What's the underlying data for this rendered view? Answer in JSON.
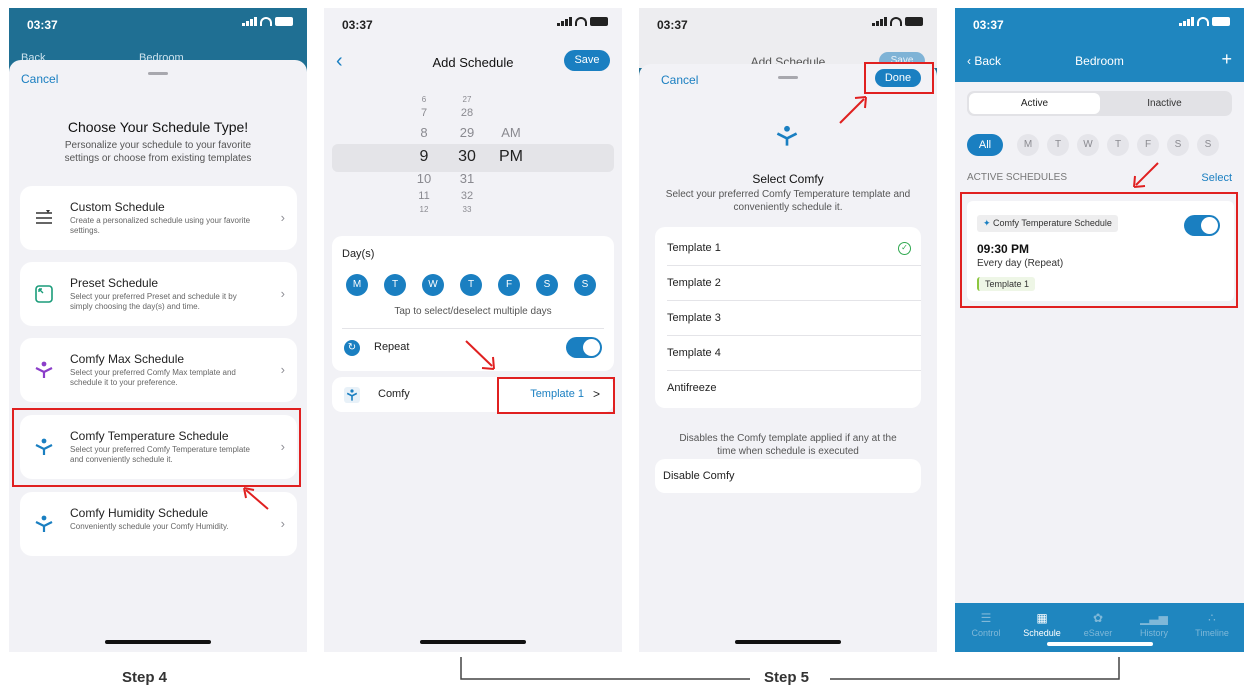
{
  "status_time": "03:37",
  "steps": {
    "step4": "Step 4",
    "step5": "Step 5"
  },
  "phone1": {
    "bg_back": "Back",
    "bg_title": "Bedroom",
    "cancel": "Cancel",
    "title": "Choose Your Schedule Type!",
    "subtitle": "Personalize your schedule to your favorite settings or choose from existing templates",
    "options": [
      {
        "title": "Custom Schedule",
        "desc": "Create a personalized schedule using your favorite settings."
      },
      {
        "title": "Preset Schedule",
        "desc": "Select your preferred Preset and schedule it by simply choosing the day(s) and time."
      },
      {
        "title": "Comfy Max Schedule",
        "desc": "Select your preferred Comfy Max template and schedule it to your preference."
      },
      {
        "title": "Comfy Temperature Schedule",
        "desc": "Select your preferred Comfy Temperature template and conveniently schedule it."
      },
      {
        "title": "Comfy Humidity Schedule",
        "desc": "Conveniently schedule your Comfy Humidity."
      }
    ]
  },
  "phone2": {
    "title": "Add Schedule",
    "save": "Save",
    "hours": [
      "6",
      "7",
      "8",
      "9",
      "10",
      "11",
      "12"
    ],
    "minutes": [
      "27",
      "28",
      "29",
      "30",
      "31",
      "32",
      "33"
    ],
    "ampm": [
      "AM",
      "PM"
    ],
    "days_label": "Day(s)",
    "days": [
      "M",
      "T",
      "W",
      "T",
      "F",
      "S",
      "S"
    ],
    "days_hint": "Tap to select/deselect multiple days",
    "repeat_label": "Repeat",
    "comfy_label": "Comfy",
    "comfy_value": "Template 1",
    "chevron": ">"
  },
  "phone3": {
    "bg_title": "Add Schedule",
    "bg_save": "Save",
    "cancel": "Cancel",
    "done": "Done",
    "title": "Select Comfy",
    "desc": "Select your preferred Comfy Temperature template and conveniently schedule it.",
    "templates": [
      "Template 1",
      "Template 2",
      "Template 3",
      "Template 4",
      "Antifreeze"
    ],
    "disable_note": "Disables the Comfy template applied if any at the time when schedule is executed",
    "disable_label": "Disable Comfy"
  },
  "phone4": {
    "back": "Back",
    "title": "Bedroom",
    "plus": "+",
    "seg_active": "Active",
    "seg_inactive": "Inactive",
    "all": "All",
    "weekdays": [
      "M",
      "T",
      "W",
      "T",
      "F",
      "S",
      "S"
    ],
    "section_label": "ACTIVE SCHEDULES",
    "select": "Select",
    "card": {
      "type": "Comfy Temperature Schedule",
      "time": "09:30 PM",
      "recurrence": "Every day (Repeat)",
      "template": "Template 1"
    },
    "tabs": [
      "Control",
      "Schedule",
      "eSaver",
      "History",
      "Timeline"
    ]
  },
  "colors": {
    "accent": "#1a7fc1",
    "highlight": "#e02020",
    "header": "#1f6f93"
  }
}
